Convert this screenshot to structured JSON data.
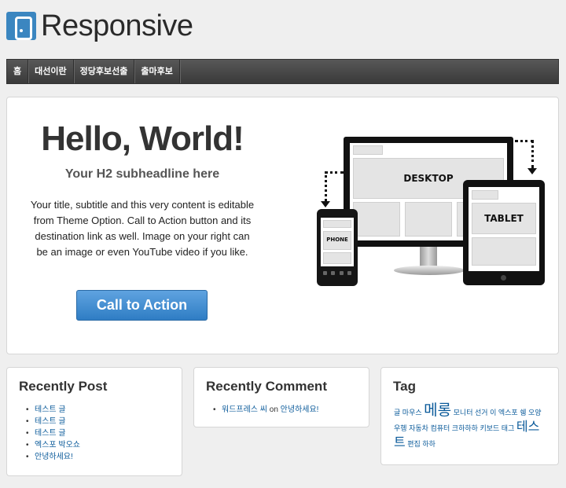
{
  "header": {
    "logo_text": "Responsive"
  },
  "nav": {
    "items": [
      "홈",
      "대선이란",
      "정당후보선출",
      "출마후보"
    ]
  },
  "hero": {
    "title": "Hello, World!",
    "subtitle": "Your H2 subheadline here",
    "body": "Your title, subtitle and this very content is editable from Theme Option. Call to Action button and its destination link as well. Image on your right can be an image or even YouTube video if you like.",
    "cta_label": "Call to Action",
    "device_labels": {
      "desktop": "DESKTOP",
      "tablet": "TABLET",
      "phone": "PHONE"
    }
  },
  "widgets": {
    "recent_posts": {
      "title": "Recently Post",
      "items": [
        "테스트 글",
        "테스트 글",
        "테스트 글",
        "엑스포 박오쇼",
        "안녕하세요!"
      ]
    },
    "recent_comments": {
      "title": "Recently Comment",
      "author": "워드프레스 씨",
      "connector": "on",
      "post": "안녕하세요!"
    },
    "tags": {
      "title": "Tag",
      "items": [
        "글",
        "마우스",
        "메롱",
        "모니터",
        "선거",
        "이",
        "엑스포",
        "쉥",
        "오양",
        "우헹",
        "자동차",
        "컴퓨터",
        "크하하하",
        "키보드",
        "태그",
        "테스트",
        "편집",
        "하하"
      ]
    }
  }
}
